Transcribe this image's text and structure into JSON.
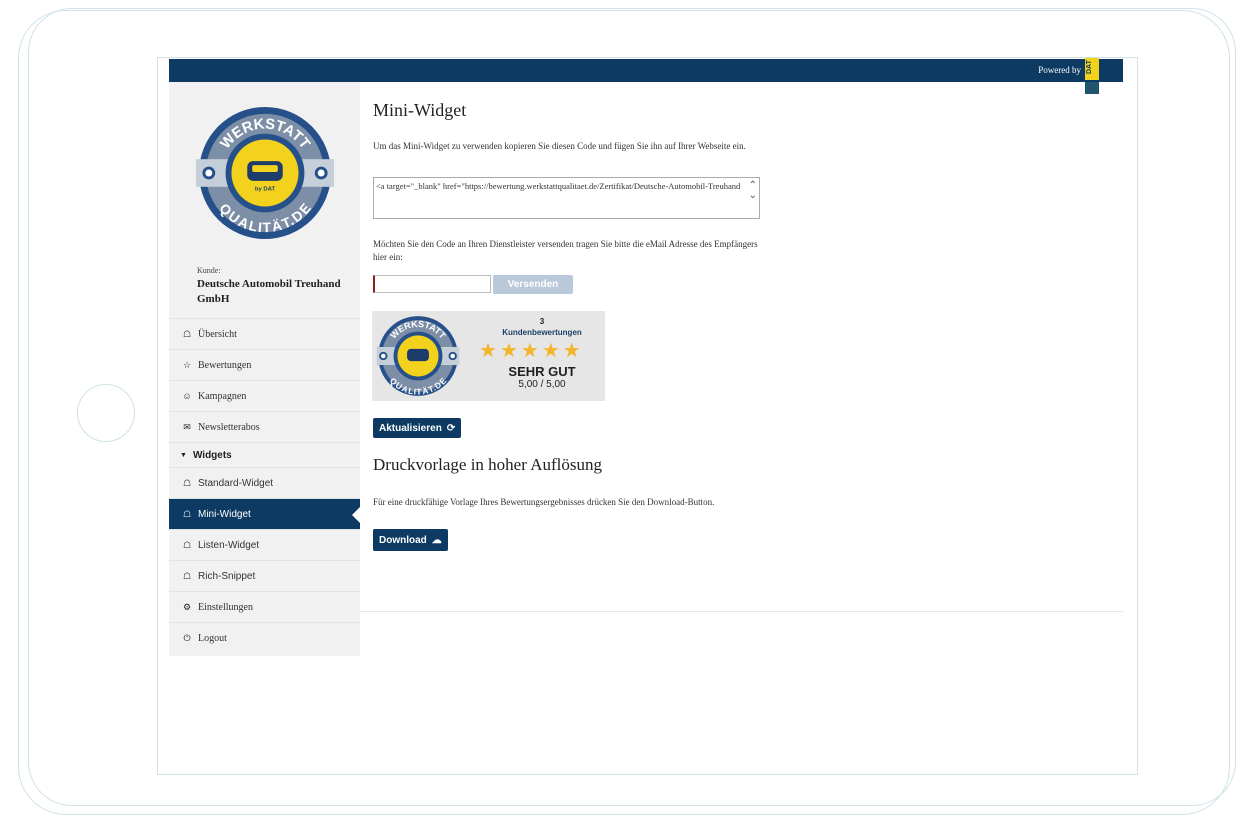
{
  "header": {
    "powered_by": "Powered by",
    "dat_logo_text": "DAT"
  },
  "sidebar": {
    "logo_text_top": "WERKSTATT",
    "logo_text_bottom": "QUALITÄT.DE",
    "logo_center_text": "by DAT",
    "kunde_label": "Kunde:",
    "kunde_name": "Deutsche Automobil Treuhand GmbH",
    "items": [
      {
        "label": "Übersicht",
        "icon": "home-icon"
      },
      {
        "label": "Bewertungen",
        "icon": "star-outline-icon"
      },
      {
        "label": "Kampagnen",
        "icon": "smiley-icon"
      },
      {
        "label": "Newsletterabos",
        "icon": "envelope-icon"
      }
    ],
    "section_label": "Widgets",
    "widget_items": [
      {
        "label": "Standard-Widget",
        "icon": "home-icon"
      },
      {
        "label": "Mini-Widget",
        "icon": "home-icon"
      },
      {
        "label": "Listen-Widget",
        "icon": "home-icon"
      },
      {
        "label": "Rich-Snippet",
        "icon": "home-icon"
      }
    ],
    "settings_label": "Einstellungen",
    "logout_label": "Logout"
  },
  "main": {
    "title": "Mini-Widget",
    "instructions": "Um das Mini-Widget zu verwenden kopieren Sie diesen Code und fügen Sie ihn auf Ihrer Webseite ein.",
    "code": "<a target=\"_blank\" href=\"https://bewertung.werkstattqualitaet.de/Zertifikat/Deutsche-Automobil-Treuhand",
    "send_instructions": "Möchten Sie den Code an Ihren Dienstleister versenden tragen Sie bitte die eMail Adresse des Empfängers hier ein:",
    "email_value": "",
    "send_button": "Versenden",
    "widget": {
      "review_count": "3",
      "review_label": "Kundenbewertungen",
      "stars": 5,
      "rating_word": "SEHR GUT",
      "score": "5,00 / 5,00"
    },
    "refresh_button": "Aktualisieren",
    "print_title": "Druckvorlage in hoher Auflösung",
    "print_text": "Für eine druckfähige Vorlage Ihres Bewertungsergebnisses drücken Sie den Download-Button.",
    "download_button": "Download"
  },
  "colors": {
    "navy": "#0c3a63",
    "star": "#f3b52a",
    "seal_yellow": "#f2d21c"
  }
}
